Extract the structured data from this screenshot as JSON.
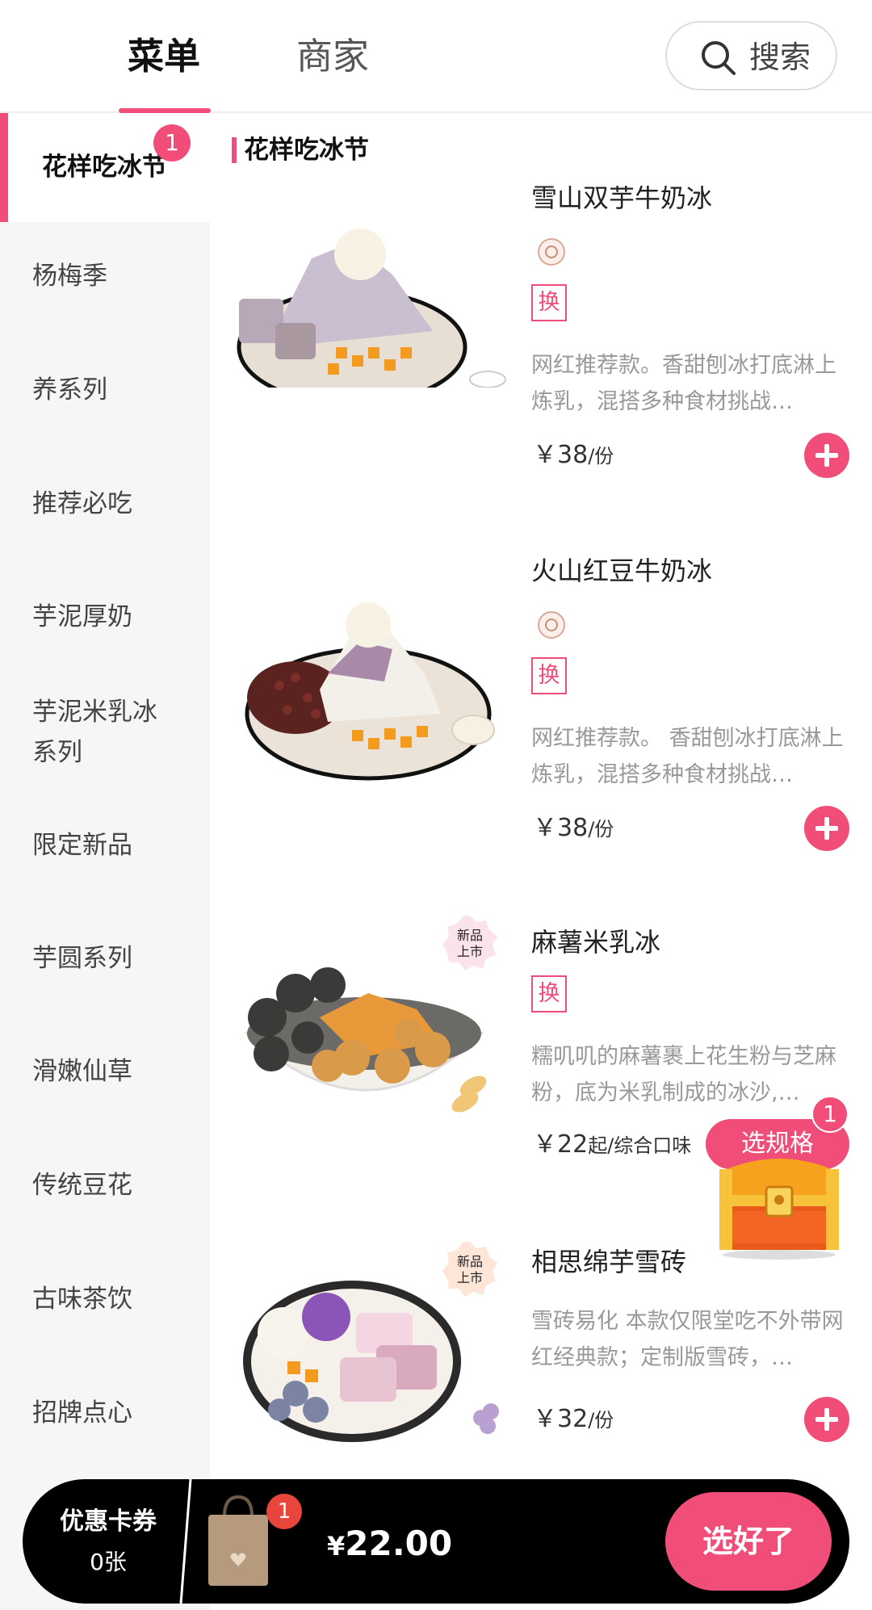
{
  "header": {
    "tabs": [
      {
        "label": "菜单",
        "active": true
      },
      {
        "label": "商家",
        "active": false
      }
    ],
    "search_label": "搜索"
  },
  "sidebar": {
    "categories": [
      {
        "label": "花样吃冰节",
        "active": true,
        "badge": "1"
      },
      {
        "label": "杨梅季"
      },
      {
        "label": "养系列"
      },
      {
        "label": "推荐必吃"
      },
      {
        "label": "芋泥厚奶"
      },
      {
        "label": "芋泥米乳冰系列"
      },
      {
        "label": "限定新品"
      },
      {
        "label": "芋圆系列"
      },
      {
        "label": "滑嫩仙草"
      },
      {
        "label": "传统豆花"
      },
      {
        "label": "古味茶饮"
      },
      {
        "label": "招牌点心"
      }
    ]
  },
  "section": {
    "title": "花样吃冰节"
  },
  "items": [
    {
      "name": "雪山双芋牛奶冰",
      "tag": "换",
      "desc": "网红推荐款。香甜刨冰打底淋上炼乳，混搭多种食材挑战…",
      "price": "￥38",
      "unit": "/份"
    },
    {
      "name": "火山红豆牛奶冰",
      "tag": "换",
      "desc": "网红推荐款。 香甜刨冰打底淋上炼乳，混搭多种食材挑战…",
      "price": "￥38",
      "unit": "/份"
    },
    {
      "name": "麻薯米乳冰",
      "tag": "换",
      "new_badge": "新品上市",
      "desc": "糯叽叽的麻薯裹上花生粉与芝麻粉，底为米乳制成的冰沙,…",
      "price": "￥22",
      "unit": "起/综合口味",
      "action": "选规格"
    },
    {
      "name": "相思绵芋雪砖",
      "new_badge": "新品上市",
      "desc": "雪砖易化 本款仅限堂吃不外带网红经典款；定制版雪砖，…",
      "price": "￥32",
      "unit": "/份"
    }
  ],
  "floating": {
    "badge": "1"
  },
  "bottom_bar": {
    "coupon_title": "优惠卡券",
    "coupon_count": "0张",
    "cart_badge": "1",
    "total_currency": "¥",
    "total_amount": "22.00",
    "confirm_label": "选好了"
  },
  "colors": {
    "accent": "#f04e78",
    "bar": "#000000",
    "sidebar_bg": "#f6f6f6"
  }
}
